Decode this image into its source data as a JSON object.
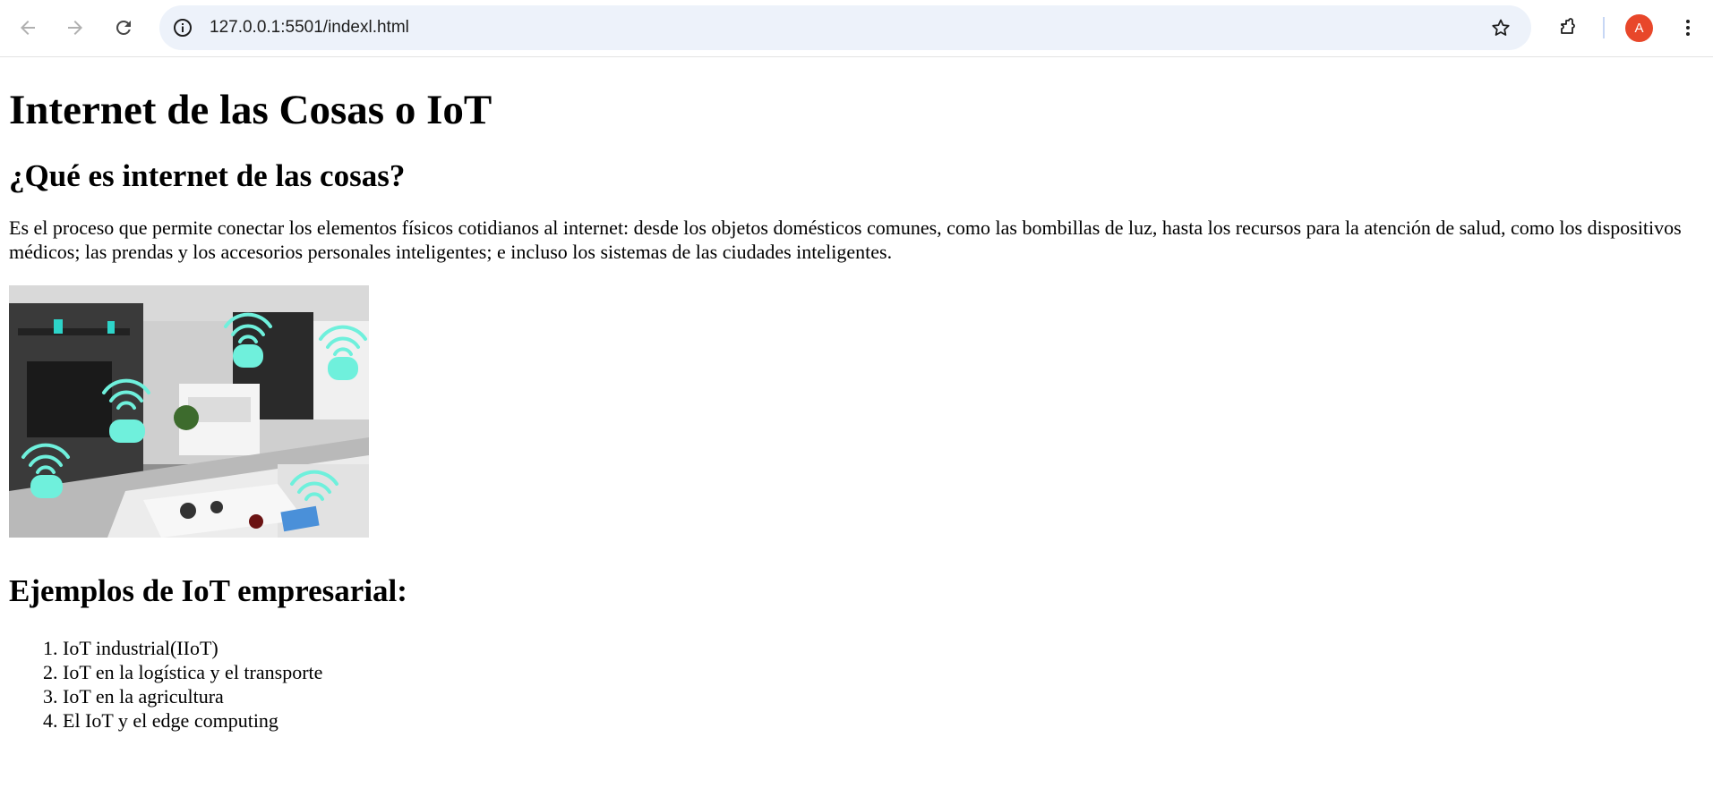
{
  "browser": {
    "url": "127.0.0.1:5501/indexl.html",
    "avatar_letter": "A",
    "accent": "#e8472a",
    "icons": [
      "back-arrow-icon",
      "forward-arrow-icon",
      "reload-icon",
      "site-info-icon",
      "bookmark-star-icon",
      "extensions-puzzle-icon",
      "kebab-menu-icon"
    ]
  },
  "page": {
    "title": "Internet de las Cosas o IoT",
    "section1_heading": "¿Qué es internet de las cosas?",
    "section1_text": "Es el proceso que permite conectar los elementos físicos cotidianos al internet: desde los objetos domésticos comunes, como las bombillas de luz, hasta los recursos para la atención de salud, como los dispositivos médicos; las prendas y los accesorios personales inteligentes; e incluso los sistemas de las ciudades inteligentes.",
    "section2_heading": "Ejemplos de IoT empresarial:",
    "examples": [
      "IoT industrial(IIoT)",
      "IoT en la logística y el transporte",
      "IoT en la agricultura",
      "El IoT y el edge computing"
    ]
  }
}
